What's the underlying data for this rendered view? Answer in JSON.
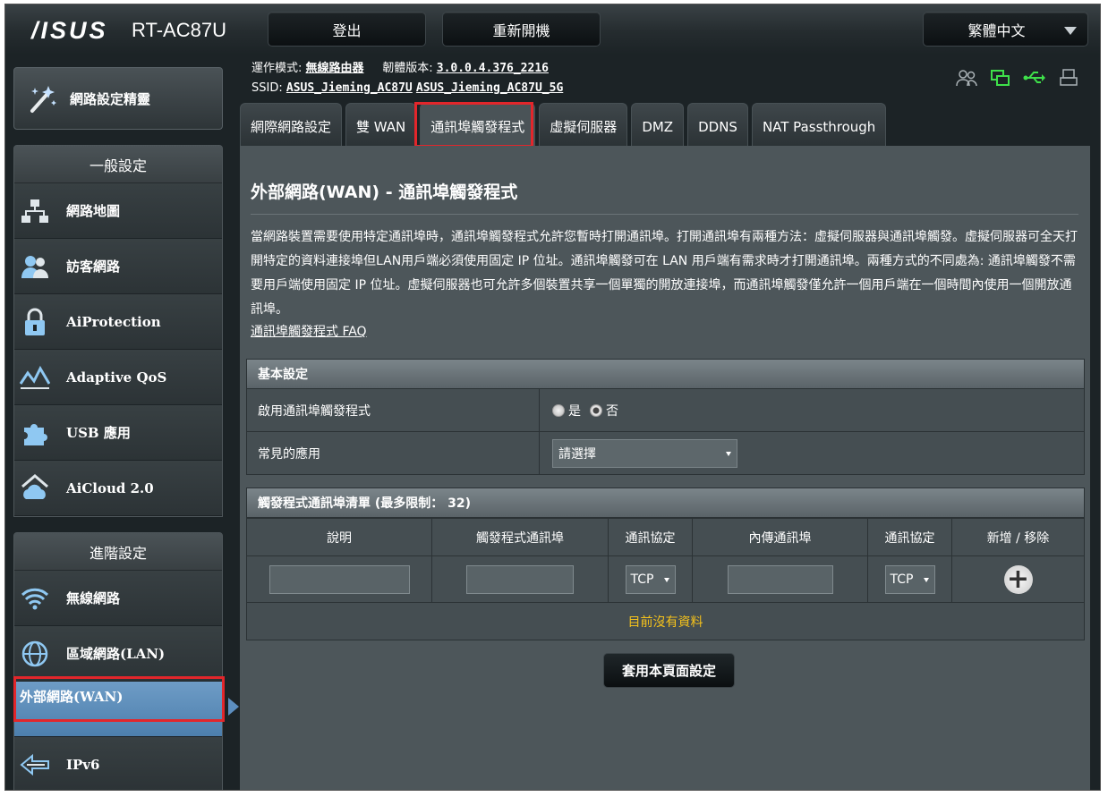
{
  "header": {
    "logo": "/ISUS",
    "model": "RT-AC87U",
    "logout_label": "登出",
    "reboot_label": "重新開機",
    "language": "繁體中文"
  },
  "sidebar": {
    "quick_setup": "網路設定精靈",
    "general_title": "一般設定",
    "general_items": [
      "網路地圖",
      "訪客網路",
      "AiProtection",
      "Adaptive QoS",
      "USB 應用",
      "AiCloud 2.0"
    ],
    "advanced_title": "進階設定",
    "advanced_items": [
      "無線網路",
      "區域網路(LAN)",
      "外部網路(WAN)",
      "IPv6"
    ],
    "active_item": "外部網路(WAN)"
  },
  "info": {
    "mode_label": "運作模式:",
    "mode_value": "無線路由器",
    "firmware_label": "韌體版本:",
    "firmware_value": "3.0.0.4.376_2216",
    "ssid_label": "SSID:",
    "ssid_1": "ASUS_Jieming_AC87U",
    "ssid_2": "ASUS_Jieming_AC87U_5G"
  },
  "status_icons": [
    "clients-icon",
    "network-icon",
    "usb-icon",
    "printer-icon"
  ],
  "tabs": [
    "網際網路設定",
    "雙 WAN",
    "通訊埠觸發程式",
    "虛擬伺服器",
    "DMZ",
    "DDNS",
    "NAT Passthrough"
  ],
  "active_tab": "通訊埠觸發程式",
  "main": {
    "title": "外部網路(WAN) - 通訊埠觸發程式",
    "description": "當網路裝置需要使用特定通訊埠時，通訊埠觸發程式允許您暫時打開通訊埠。打開通訊埠有兩種方法：虛擬伺服器與通訊埠觸發。虛擬伺服器可全天打開特定的資料連接埠但LAN用戶端必須使用固定 IP 位址。通訊埠觸發可在 LAN 用戶端有需求時才打開通訊埠。兩種方式的不同處為: 通訊埠觸發不需要用戶端使用固定 IP 位址。虛擬伺服器也可允許多個裝置共享一個單獨的開放連接埠，而通訊埠觸發僅允許一個用戶端在一個時間內使用一個開放通訊埠。",
    "faq_link": "通訊埠觸發程式 FAQ"
  },
  "basic": {
    "header": "基本設定",
    "enable_label": "啟用通訊埠觸發程式",
    "yes": "是",
    "no": "否",
    "enabled": false,
    "app_label": "常見的應用",
    "app_value": "請選擇"
  },
  "trigger_list": {
    "header": "觸發程式通訊埠清單 (最多限制： 32)",
    "columns": [
      "說明",
      "觸發程式通訊埠",
      "通訊協定",
      "內傳通訊埠",
      "通訊協定",
      "新增 / 移除"
    ],
    "protocol_1": "TCP",
    "protocol_2": "TCP",
    "add_symbol": "+",
    "empty_text": "目前沒有資料"
  },
  "apply_label": "套用本頁面設定",
  "colors": {
    "highlight": "#e2262b",
    "active_menu": "#5c8ebf",
    "empty_text": "#f5c21b"
  }
}
